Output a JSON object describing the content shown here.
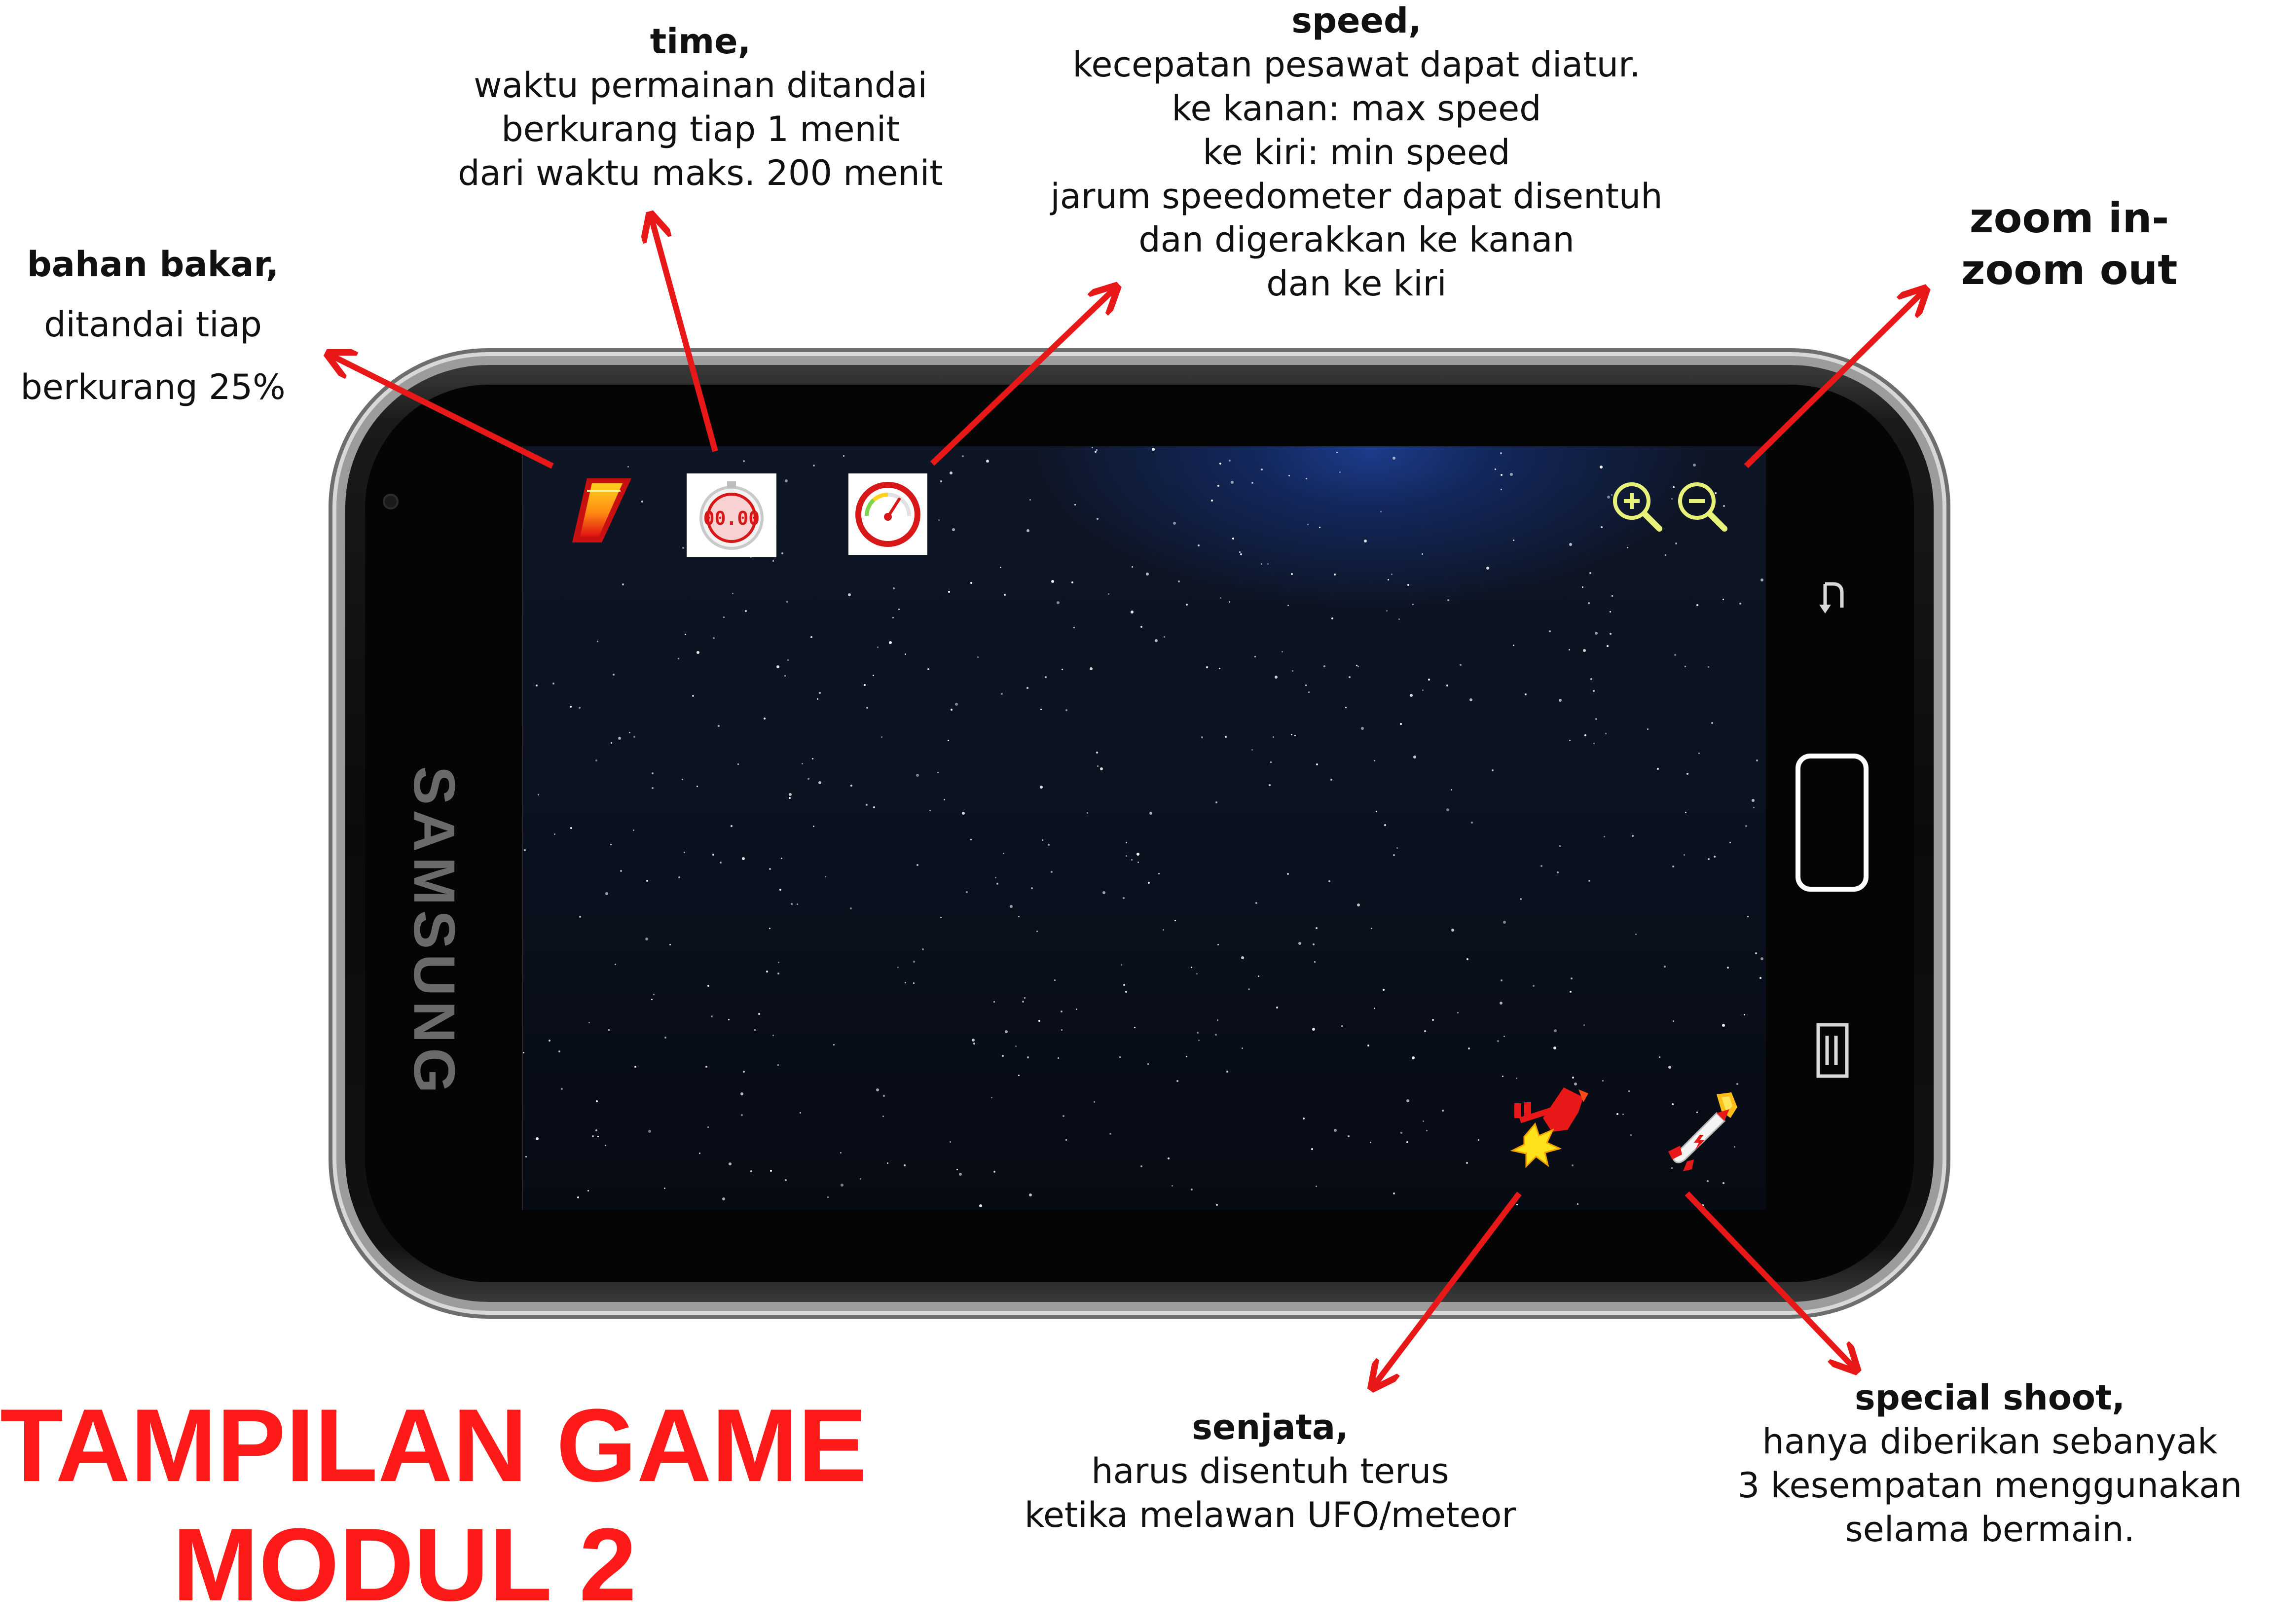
{
  "device": {
    "brand": "SAMSUNG"
  },
  "annotations": {
    "fuel": {
      "heading": "bahan bakar,",
      "lines": [
        "ditandai tiap",
        "berkurang 25%"
      ]
    },
    "time": {
      "heading": "time,",
      "lines": [
        "waktu permainan ditandai",
        "berkurang tiap 1 menit",
        "dari waktu maks. 200 menit"
      ]
    },
    "speed": {
      "heading": "speed,",
      "lines": [
        "kecepatan pesawat dapat diatur.",
        "ke kanan: max speed",
        "ke kiri: min speed",
        "jarum speedometer dapat disentuh",
        "dan digerakkan ke kanan",
        "dan ke kiri"
      ]
    },
    "zoom": {
      "lines": [
        "zoom in-",
        "zoom out"
      ]
    },
    "weapon": {
      "heading": "senjata,",
      "lines": [
        "harus disentuh terus",
        "ketika melawan UFO/meteor"
      ]
    },
    "special": {
      "heading": "special shoot,",
      "lines": [
        "hanya diberikan sebanyak",
        "3 kesempatan menggunakan",
        "selama bermain."
      ]
    }
  },
  "hud": {
    "timer_display": "00.00"
  },
  "title": {
    "line1": "TAMPILAN GAME",
    "line2": "MODUL 2"
  },
  "colors": {
    "arrow": "#e81818",
    "title": "#ff1a1a",
    "zoom_icon": "#e8f27a",
    "space": "#0b1220"
  }
}
